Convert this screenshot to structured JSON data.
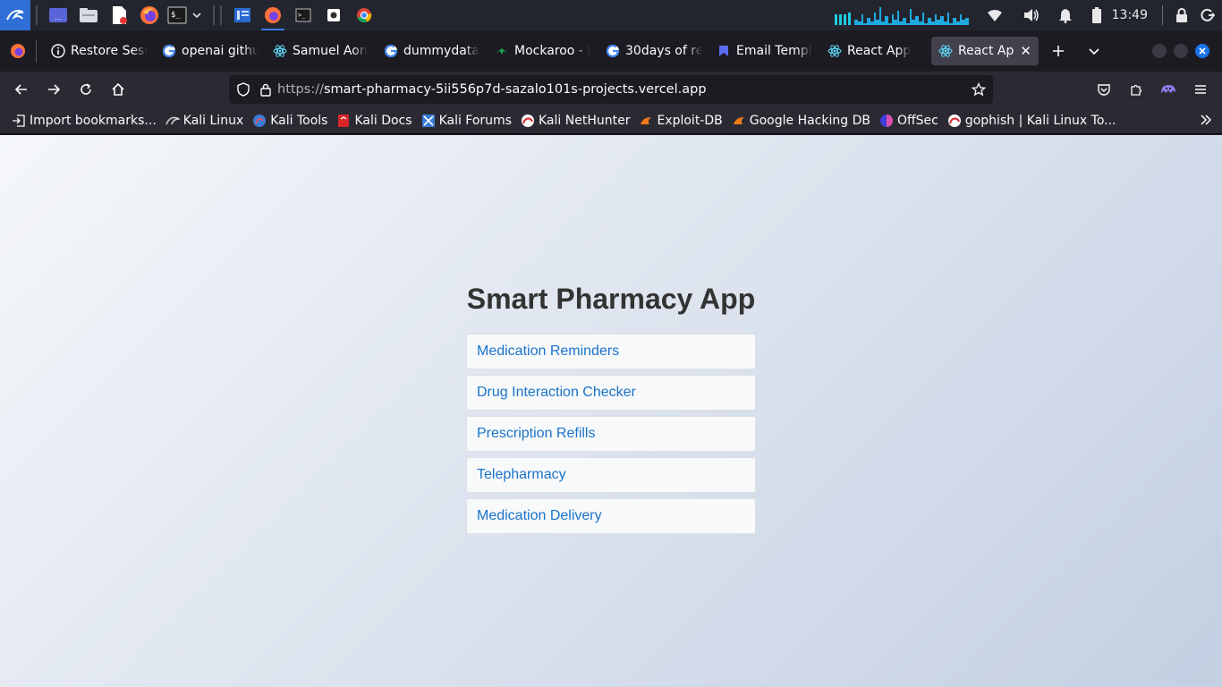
{
  "taskbar": {
    "apps": [
      "kali-menu",
      "workspace",
      "file-manager",
      "text-editor",
      "firefox",
      "terminal",
      "dropdown"
    ],
    "running": [
      "panel-app",
      "firefox",
      "terminal",
      "screenshot-tool",
      "chrome"
    ],
    "clock": "13:49"
  },
  "tabs": [
    {
      "title": "Restore Sess",
      "icon": "info-icon"
    },
    {
      "title": "openai githu",
      "icon": "google-icon"
    },
    {
      "title": "Samuel Aon",
      "icon": "react-icon"
    },
    {
      "title": "dummydata",
      "icon": "google-icon"
    },
    {
      "title": "Mockaroo - I",
      "icon": "mockaroo-icon"
    },
    {
      "title": "30days of re",
      "icon": "google-icon"
    },
    {
      "title": "Email Templ",
      "icon": "email-template-icon"
    },
    {
      "title": "React App",
      "icon": "react-icon"
    },
    {
      "title": "React App",
      "icon": "react-icon",
      "active": true
    }
  ],
  "address": {
    "scheme": "https://",
    "host": "smart-pharmacy-5ii556p7d-sazalo101s-projects.vercel.app"
  },
  "bookmarks": [
    {
      "label": "Import bookmarks...",
      "icon": "import-icon"
    },
    {
      "label": "Kali Linux",
      "icon": "kali-icon"
    },
    {
      "label": "Kali Tools",
      "icon": "kali-tools-icon"
    },
    {
      "label": "Kali Docs",
      "icon": "kali-docs-icon"
    },
    {
      "label": "Kali Forums",
      "icon": "kali-forums-icon"
    },
    {
      "label": "Kali NetHunter",
      "icon": "nethunter-icon"
    },
    {
      "label": "Exploit-DB",
      "icon": "exploit-db-icon"
    },
    {
      "label": "Google Hacking DB",
      "icon": "ghdb-icon"
    },
    {
      "label": "OffSec",
      "icon": "offsec-icon"
    },
    {
      "label": "gophish | Kali Linux To...",
      "icon": "gophish-icon"
    }
  ],
  "app": {
    "title": "Smart Pharmacy App",
    "features": [
      "Medication Reminders",
      "Drug Interaction Checker",
      "Prescription Refills",
      "Telepharmacy",
      "Medication Delivery"
    ]
  },
  "colors": {
    "link": "#1a73c8",
    "title": "#333333",
    "accent": "#367bf0"
  }
}
